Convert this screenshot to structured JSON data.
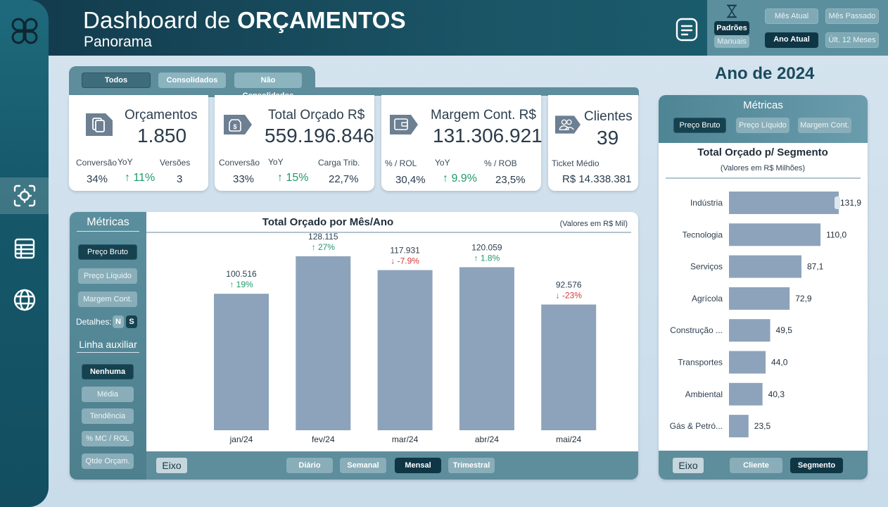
{
  "header": {
    "title_prefix": "Dashboard de",
    "title_bold": "ORÇAMENTOS",
    "subtitle": "Panorama"
  },
  "period_mode": {
    "active": "Padrões",
    "inactive": "Manuais"
  },
  "period_buttons": {
    "current_month": "Mês Atual",
    "last_month": "Mês Passado",
    "current_year": "Ano Atual",
    "last_12": "Últ. 12 Meses"
  },
  "year_label": "Ano de 2024",
  "filter_tabs": {
    "all": "Todos",
    "consolidated": "Consolidados",
    "not_consolidated": "Não Consolidados"
  },
  "kpis": {
    "orcamentos": {
      "title": "Orçamentos",
      "value": "1.850",
      "labels": [
        "Conversão",
        "YoY",
        "Versões"
      ],
      "values": [
        "34%",
        "↑ 11%",
        "3"
      ]
    },
    "total_orcado": {
      "title": "Total Orçado R$",
      "value": "559.196.846",
      "labels": [
        "Conversão",
        "YoY",
        "Carga Trib."
      ],
      "values": [
        "33%",
        "↑ 15%",
        "22,7%"
      ]
    },
    "margem": {
      "title": "Margem Cont. R$",
      "value": "131.306.921",
      "labels": [
        "% / ROL",
        "YoY",
        "% / ROB"
      ],
      "values": [
        "30,4%",
        "↑ 9.9%",
        "23,5%"
      ]
    },
    "clientes": {
      "title": "Clientes",
      "value": "39",
      "labels": [
        "Ticket Médio"
      ],
      "values": [
        "R$ 14.338.381"
      ]
    }
  },
  "left_panel": {
    "metrics_title": "Métricas",
    "metrics": [
      "Preço Bruto",
      "Preço Líquido",
      "Margem Cont."
    ],
    "details_label": "Detalhes:",
    "details_opts": [
      "N",
      "S"
    ],
    "aux_title": "Linha auxiliar",
    "aux_opts": [
      "Nenhuma",
      "Média",
      "Tendência",
      "% MC / ROL",
      "Qtde Orçam."
    ]
  },
  "monthly_chart": {
    "axis_label": "Eixo",
    "granularity": [
      "Diário",
      "Semanal",
      "Mensal",
      "Trimestral"
    ]
  },
  "segment_panel": {
    "metrics_title": "Métricas",
    "metrics": [
      "Preço Bruto",
      "Preço Líquido",
      "Margem Cont."
    ],
    "axis_label": "Eixo",
    "axis_opts": [
      "Cliente",
      "Segmento"
    ]
  },
  "chart_data": [
    {
      "type": "bar",
      "title": "Total Orçado por Mês/Ano",
      "subtitle": "(Valores em R$ Mil)",
      "categories": [
        "jan/24",
        "fev/24",
        "mar/24",
        "abr/24",
        "mai/24"
      ],
      "values": [
        100516,
        128115,
        117931,
        120059,
        92576
      ],
      "value_labels": [
        "100.516",
        "128.115",
        "117.931",
        "120.059",
        "92.576"
      ],
      "yoy_labels": [
        "↑ 19%",
        "↑ 27%",
        "↓ -7.9%",
        "↑ 1.8%",
        "↓ -23%"
      ],
      "yoy_direction": [
        "up",
        "up",
        "down",
        "up",
        "down"
      ],
      "ylim": [
        0,
        140000
      ],
      "bar_color": "#8da3bb",
      "up_color": "#1f9a6c",
      "down_color": "#d23a3a"
    },
    {
      "type": "bar",
      "orientation": "horizontal",
      "title": "Total Orçado p/ Segmento",
      "subtitle": "(Valores em R$ Milhões)",
      "categories": [
        "Indústria",
        "Tecnologia",
        "Serviços",
        "Agrícola",
        "Construção ...",
        "Transportes",
        "Ambiental",
        "Gás & Petró..."
      ],
      "values": [
        131.9,
        110.0,
        87.1,
        72.9,
        49.5,
        44.0,
        40.3,
        23.5
      ],
      "value_labels": [
        "131,9",
        "110,0",
        "87,1",
        "72,9",
        "49,5",
        "44,0",
        "40,3",
        "23,5"
      ],
      "xlim": [
        0,
        131.9
      ],
      "bar_color": "#8da3bb"
    }
  ]
}
